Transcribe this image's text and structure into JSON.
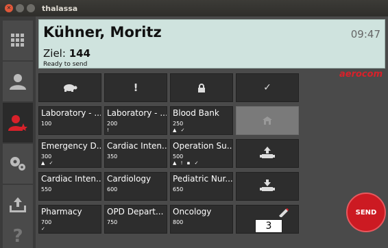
{
  "window": {
    "title": "thalassa"
  },
  "header": {
    "name": "Kühner, Moritz",
    "time": "09:47",
    "ziel_label": "Ziel:",
    "ziel_value": "144",
    "status": "Ready to send"
  },
  "brand": "aerocom",
  "actions": {
    "send_label": "SEND",
    "counter": "3"
  },
  "destinations": [
    {
      "name": "Laboratory - ...",
      "code": "100",
      "flags": ""
    },
    {
      "name": "Laboratory - ...",
      "code": "200",
      "flags": "!"
    },
    {
      "name": "Blood Bank",
      "code": "250",
      "flags": "▲ ✓"
    },
    {
      "name": "Emergency D...",
      "code": "300",
      "flags": "▲ ✓"
    },
    {
      "name": "Cardiac Inten...",
      "code": "350",
      "flags": ""
    },
    {
      "name": "Operation Su...",
      "code": "500",
      "flags": "▲ ! ▪ ✓"
    },
    {
      "name": "Cardiac Inten...",
      "code": "550",
      "flags": ""
    },
    {
      "name": "Cardiology",
      "code": "600",
      "flags": ""
    },
    {
      "name": "Pediatric Nur...",
      "code": "650",
      "flags": ""
    },
    {
      "name": "Pharmacy",
      "code": "700",
      "flags": "✓"
    },
    {
      "name": "OPD Depart...",
      "code": "750",
      "flags": ""
    },
    {
      "name": "Oncology",
      "code": "800",
      "flags": ""
    }
  ],
  "icons": {
    "sidebar": [
      "grid-icon",
      "user-icon",
      "user-star-icon",
      "gears-icon",
      "upload-icon",
      "help-icon"
    ],
    "options": [
      "turtle-icon",
      "exclamation-icon",
      "lock-icon",
      "check-icon"
    ]
  },
  "colors": {
    "header_bg": "#cfe3de",
    "brand": "#d8212a",
    "tile_bg": "#2d2d2d",
    "active_user": "#d8212a",
    "send": "#cc1a22"
  }
}
